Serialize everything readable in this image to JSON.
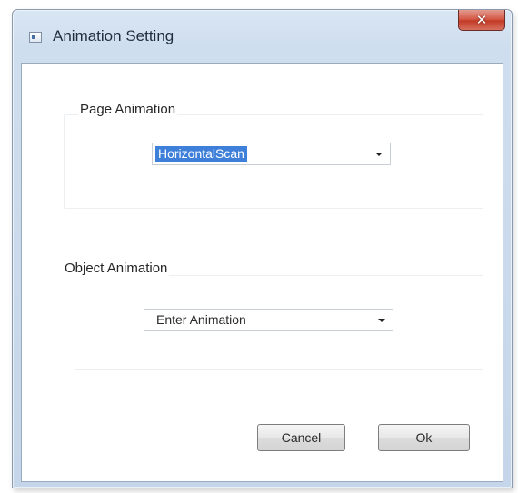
{
  "window": {
    "title": "Animation Setting",
    "close_label": "✕"
  },
  "page_animation": {
    "label": "Page Animation",
    "selected_value": "HorizontalScan"
  },
  "object_animation": {
    "label": "Object Animation",
    "selected_value": "Enter Animation"
  },
  "buttons": {
    "cancel_label": "Cancel",
    "ok_label": "Ok"
  },
  "colors": {
    "selection_highlight": "#3d7fd9",
    "close_button": "#c23b26",
    "title_bar": "#cfdeee"
  },
  "icons": {
    "window_icon": "app-window-icon",
    "dropdown_arrow": "chevron-down-icon"
  }
}
